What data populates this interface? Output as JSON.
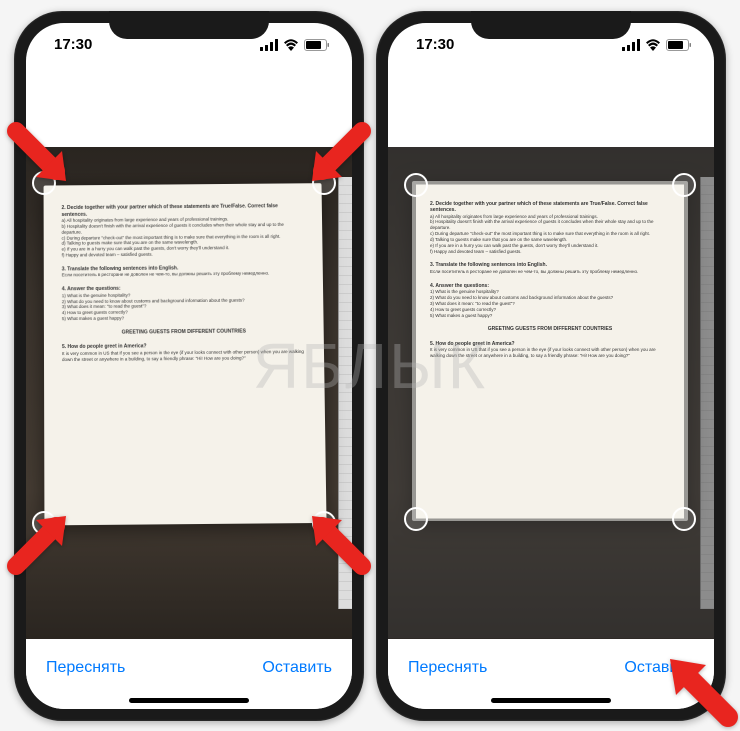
{
  "status": {
    "time": "17:30"
  },
  "buttons": {
    "retake": "Переснять",
    "keep": "Оставить"
  },
  "document": {
    "q2_title": "2. Decide together with your partner which of these statements are True/False. Correct false sentences.",
    "q2_a": "a) All hospitality originates from large experience and years of professional trainings.",
    "q2_b": "b) Hospitality doesn't finish with the arrival experience of guests it concludes when their whole stay and up to the departure.",
    "q2_c": "c) During departure \"check-out\" the most important thing is to make sure that everything in the room is all right.",
    "q2_d": "d) Talking to guests make sure that you are on the same wavelength.",
    "q2_e": "e) If you are in a hurry you can walk past the guests, don't worry they'll understand it.",
    "q2_f": "f) Happy and devoted team – satisfied guests.",
    "q3_title": "3. Translate the following sentences into English.",
    "q4_title": "4. Answer the questions:",
    "q4_1": "1) What is the genuine hospitality?",
    "q4_2": "2) What do you need to know about customs and background information about the guests?",
    "q4_3": "3) What does it mean: \"to read the guest\"?",
    "q4_4": "4) How to greet guests correctly?",
    "q4_5": "5) What makes a guest happy?",
    "q5_heading": "GREETING GUESTS FROM DIFFERENT COUNTRIES",
    "q5_title": "5. How do people greet in America?",
    "q5_body": "It is very common in US that if you see a person in the eye (if your looks connect with other person) when you are walking down the street or anywhere in a building, to say a friendly phrase: \"Hi! How are you doing?\""
  },
  "watermark": "ЯБЛЫК"
}
